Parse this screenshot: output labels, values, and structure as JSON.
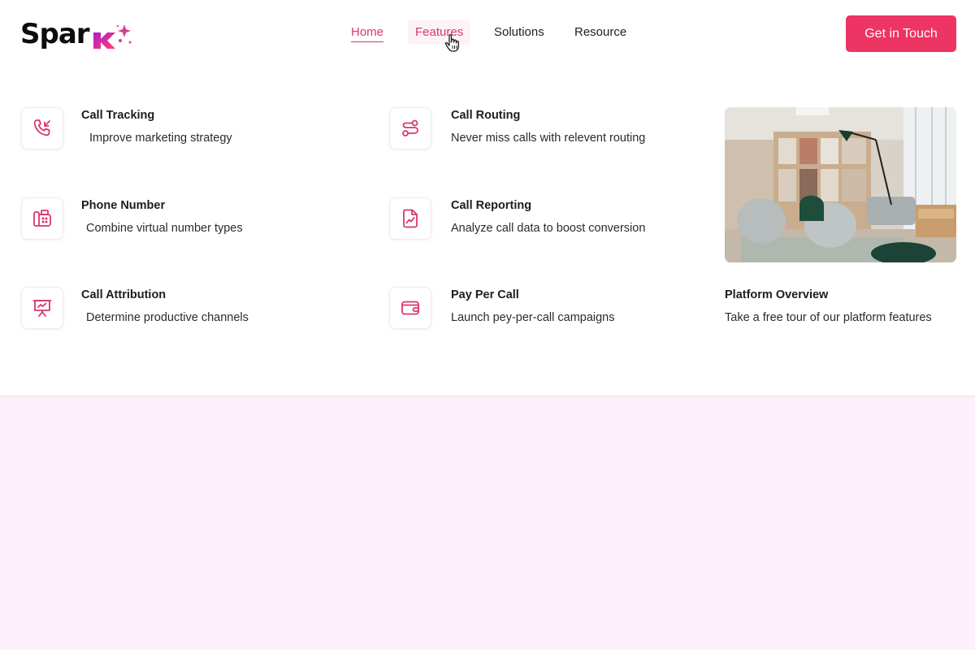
{
  "brand": {
    "logo_text": "Spar",
    "logo_letter": "k",
    "accent": "#ed3463",
    "pink": "#d8386a"
  },
  "nav": {
    "items": [
      {
        "label": "Home",
        "active": true
      },
      {
        "label": "Features",
        "hovered": true
      },
      {
        "label": "Solutions"
      },
      {
        "label": "Resource"
      }
    ],
    "cta_label": "Get in Touch"
  },
  "features": [
    {
      "title": "Call Tracking",
      "desc": "Improve marketing strategy",
      "icon": "phone-incoming-icon"
    },
    {
      "title": "Call Routing",
      "desc": "Never miss calls with relevent routing",
      "icon": "route-icon"
    },
    {
      "title": "Phone Number",
      "desc": "Combine virtual number types",
      "icon": "desk-phone-icon"
    },
    {
      "title": "Call Reporting",
      "desc": "Analyze call data to boost conversion",
      "icon": "report-chart-icon"
    },
    {
      "title": "Call Attribution",
      "desc": "Determine productive channels",
      "icon": "presentation-icon"
    },
    {
      "title": "Pay Per Call",
      "desc": "Launch pey-per-call campaigns",
      "icon": "wallet-icon"
    }
  ],
  "overview": {
    "title": "Platform Overview",
    "desc": "Take a free tour of our platform features"
  }
}
